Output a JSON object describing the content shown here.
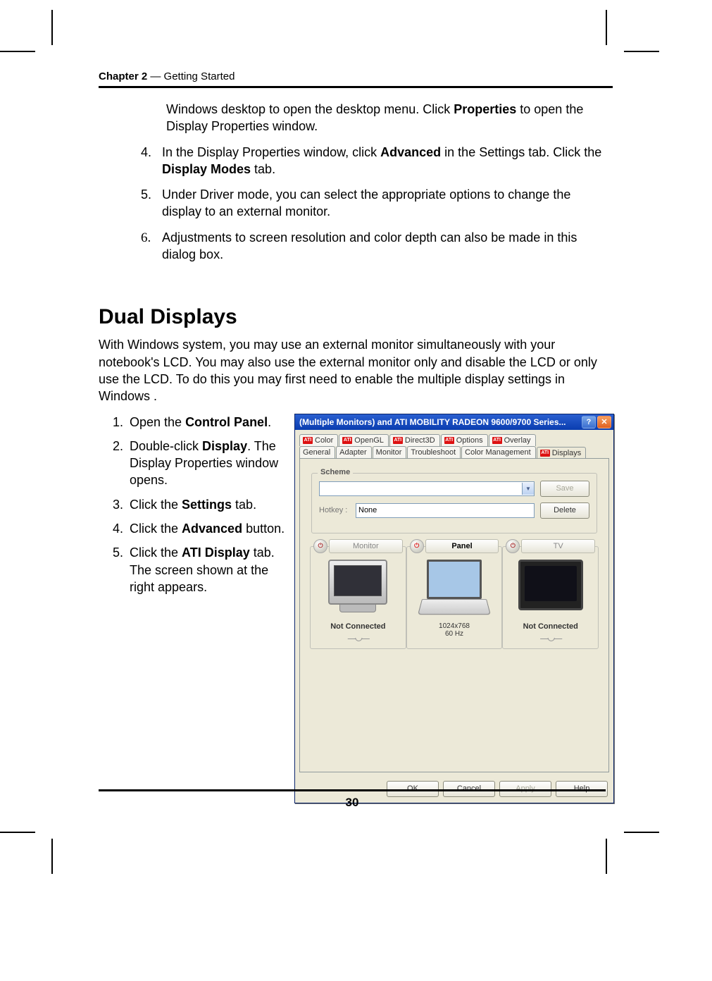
{
  "header": {
    "chapter": "Chapter 2",
    "sep": " — ",
    "title": "Getting Started"
  },
  "intro_cont": [
    {
      "pre": "Windows desktop to open the desktop menu. Click ",
      "b1": "Properties",
      "post": " to open the Display Properties window."
    }
  ],
  "list1": [
    {
      "n": "4.",
      "pre": "In the Display Properties window, click ",
      "b1": "Advanced",
      "mid": " in the Settings tab. Click the ",
      "b2": "Display Modes",
      "post": " tab."
    },
    {
      "n": "5.",
      "txt": "Under Driver mode, you can select the appropriate options to change the display to an external monitor."
    },
    {
      "n": "6.",
      "txt": "Adjustments to screen resolution and color depth can also be made in this dialog box."
    }
  ],
  "section_title": "Dual Displays",
  "section_para": "With Windows system, you may use an external monitor simultaneously with your notebook's LCD. You may also use the external monitor only and disable the LCD or only use the LCD. To do this you may first need to enable the multiple display settings in Windows .",
  "steps": [
    {
      "n": "1.",
      "pre": "Open the ",
      "b1": "Control Panel",
      "post": "."
    },
    {
      "n": "2.",
      "pre": "Double-click ",
      "b1": "Display",
      "post": ". The Display Properties window opens."
    },
    {
      "n": "3.",
      "pre": "Click the ",
      "b1": "Settings",
      "post": " tab."
    },
    {
      "n": "4.",
      "pre": "Click the ",
      "b1": "Advanced",
      "post": " button."
    },
    {
      "n": "5.",
      "pre": "Click the ",
      "b1": "ATI Display",
      "post": " tab. The screen shown at the right appears."
    }
  ],
  "dialog": {
    "title": "(Multiple Monitors) and ATI MOBILITY RADEON 9600/9700 Series...",
    "help": "?",
    "close": "✕",
    "tabs_row1": [
      "Color",
      "OpenGL",
      "Direct3D",
      "Options",
      "Overlay"
    ],
    "tabs_row2_plain": [
      "General",
      "Adapter",
      "Monitor",
      "Troubleshoot",
      "Color Management"
    ],
    "tabs_row2_ati": "Displays",
    "scheme_label": "Scheme",
    "scheme_value": "",
    "hotkey_label": "Hotkey :",
    "hotkey_value": "None",
    "save_btn": "Save",
    "delete_btn": "Delete",
    "displays": [
      {
        "name": "Monitor",
        "status": "Not Connected",
        "sub1": "",
        "sub2": "",
        "on": false,
        "device": "crt"
      },
      {
        "name": "Panel",
        "status": "",
        "sub1": "1024x768",
        "sub2": "60 Hz",
        "on": true,
        "device": "laptop"
      },
      {
        "name": "TV",
        "status": "Not Connected",
        "sub1": "",
        "sub2": "",
        "on": false,
        "device": "tv"
      }
    ],
    "buttons": {
      "ok": "OK",
      "cancel": "Cancel",
      "apply": "Apply",
      "help": "Help"
    }
  },
  "page_number": "30"
}
